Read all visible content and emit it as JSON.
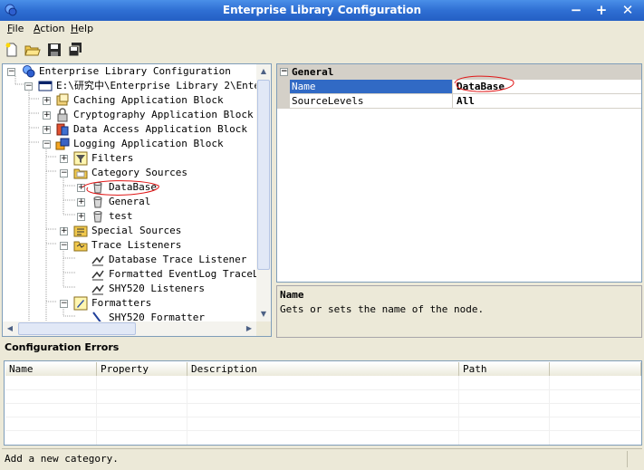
{
  "window": {
    "title": "Enterprise Library Configuration"
  },
  "menu": {
    "file": "File",
    "action": "Action",
    "help": "Help"
  },
  "toolbar": [
    "new-icon",
    "open-icon",
    "save-icon",
    "save-all-icon"
  ],
  "tree": [
    {
      "label": "Enterprise Library Configuration",
      "icon": "app-icon"
    },
    {
      "label": "E:\\研究中\\Enterprise Library 2\\Enterp",
      "icon": "window-icon"
    },
    {
      "label": "Caching Application Block",
      "icon": "block-icon"
    },
    {
      "label": "Cryptography Application Block",
      "icon": "lock-icon"
    },
    {
      "label": "Data Access Application Block",
      "icon": "data-icon"
    },
    {
      "label": "Logging Application Block",
      "icon": "log-icon"
    },
    {
      "label": "Filters",
      "icon": "filter-icon"
    },
    {
      "label": "Category Sources",
      "icon": "folder-icon"
    },
    {
      "label": "DataBase",
      "icon": "bucket-icon"
    },
    {
      "label": "General",
      "icon": "bucket-icon"
    },
    {
      "label": "test",
      "icon": "bucket-icon"
    },
    {
      "label": "Special Sources",
      "icon": "special-icon"
    },
    {
      "label": "Trace Listeners",
      "icon": "folder-icon"
    },
    {
      "label": "Database Trace Listener",
      "icon": "listener-icon"
    },
    {
      "label": "Formatted EventLog TraceLis",
      "icon": "listener-icon"
    },
    {
      "label": "SHY520 Listeners",
      "icon": "listener-icon"
    },
    {
      "label": "Formatters",
      "icon": "formatter-folder-icon"
    },
    {
      "label": "SHY520 Formatter",
      "icon": "pen-icon"
    }
  ],
  "properties": {
    "category": "General",
    "rows": [
      {
        "name": "Name",
        "value": "DataBase"
      },
      {
        "name": "SourceLevels",
        "value": "All"
      }
    ]
  },
  "description": {
    "title": "Name",
    "text": "Gets or sets the name of the node."
  },
  "errors": {
    "title": "Configuration Errors",
    "columns": [
      "Name",
      "Property",
      "Description",
      "Path"
    ]
  },
  "status": "Add a new category.",
  "colors": {
    "selection": "#316ac5",
    "titlebar": "#2f6fd3",
    "annotation": "#e01818"
  }
}
